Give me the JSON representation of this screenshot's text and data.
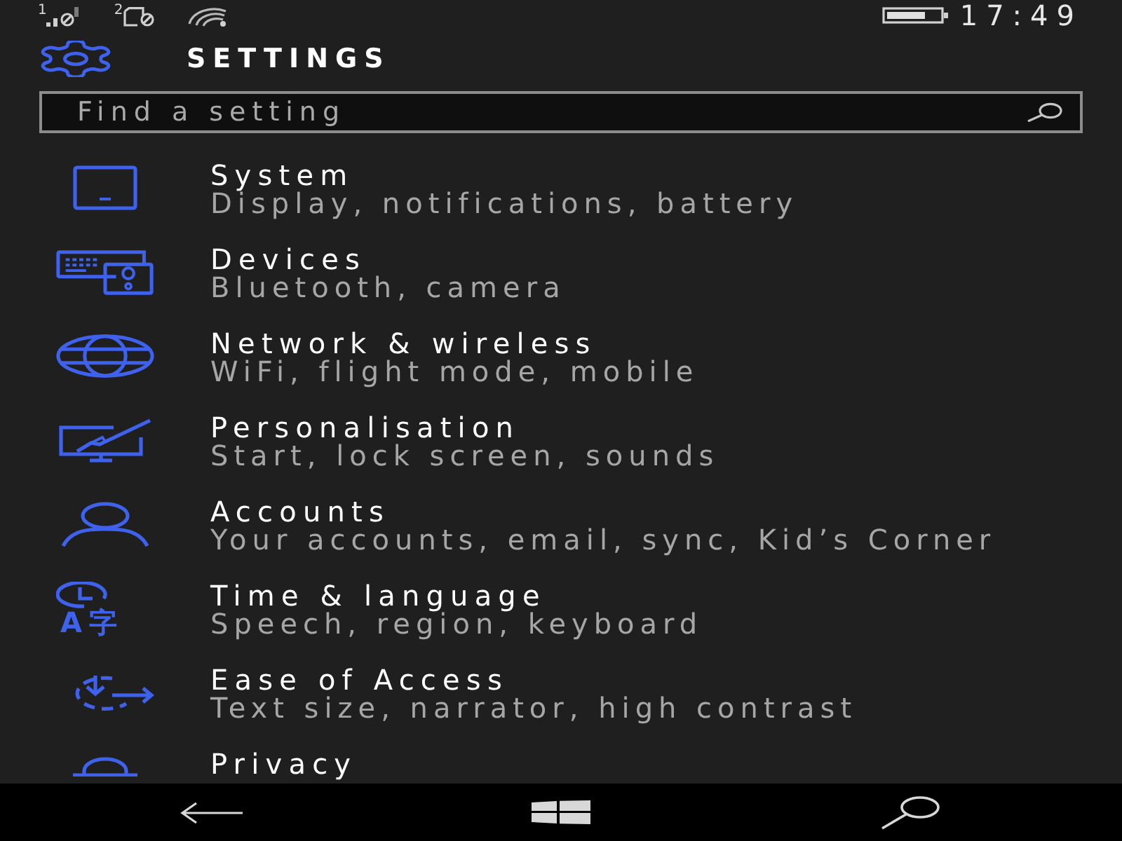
{
  "status_bar": {
    "sim_labels": [
      "1",
      "2"
    ],
    "time": "17:49"
  },
  "header": {
    "title": "SETTINGS"
  },
  "search": {
    "placeholder": "Find a setting"
  },
  "categories": [
    {
      "kind": "system",
      "title": "System",
      "subtitle": "Display, notifications, battery"
    },
    {
      "kind": "devices",
      "title": "Devices",
      "subtitle": "Bluetooth, camera"
    },
    {
      "kind": "network",
      "title": "Network & wireless",
      "subtitle": "WiFi, flight mode, mobile"
    },
    {
      "kind": "personalisation",
      "title": "Personalisation",
      "subtitle": "Start, lock screen, sounds"
    },
    {
      "kind": "accounts",
      "title": "Accounts",
      "subtitle": "Your accounts, email, sync, Kid’s Corner"
    },
    {
      "kind": "time",
      "title": "Time & language",
      "subtitle": "Speech, region, keyboard",
      "icon_text": "A字"
    },
    {
      "kind": "ease",
      "title": "Ease of Access",
      "subtitle": "Text size, narrator, high contrast"
    },
    {
      "kind": "privacy",
      "title": "Privacy"
    }
  ]
}
